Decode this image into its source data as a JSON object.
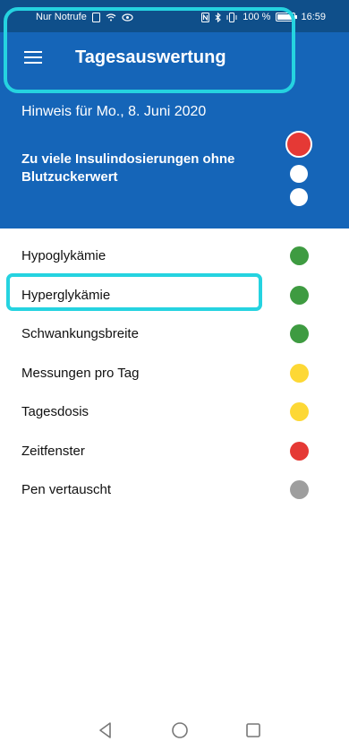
{
  "status_bar": {
    "carrier": "Nur Notrufe",
    "battery": "100 %",
    "time": "16:59"
  },
  "appbar": {
    "title": "Tagesauswertung",
    "menu_icon": "hamburger-menu-icon"
  },
  "hero": {
    "hint": "Hinweis für Mo., 8. Juni 2020",
    "warning": "Zu viele Insulindosierungen ohne Blutzuckerwert",
    "traffic_light": [
      "red",
      "white",
      "white"
    ]
  },
  "colors": {
    "status_bar": "#0f4f8a",
    "primary": "#1565b8",
    "focus": "#25d3e0",
    "green": "#3e9b41",
    "yellow": "#fdd835",
    "red": "#e53935",
    "grey": "#9e9e9e"
  },
  "rows": [
    {
      "label": "Hypoglykämie",
      "status": "green"
    },
    {
      "label": "Hyperglykämie",
      "status": "green"
    },
    {
      "label": "Schwankungsbreite",
      "status": "green"
    },
    {
      "label": "Messungen pro Tag",
      "status": "yellow"
    },
    {
      "label": "Tagesdosis",
      "status": "yellow"
    },
    {
      "label": "Zeitfenster",
      "status": "red"
    },
    {
      "label": "Pen vertauscht",
      "status": "grey"
    }
  ],
  "navbar": {
    "icons": [
      "back-icon",
      "home-icon",
      "recent-apps-icon"
    ]
  }
}
